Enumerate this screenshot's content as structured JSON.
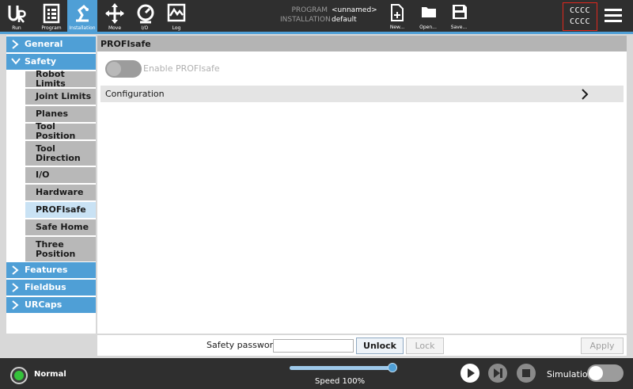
{
  "topbar": {
    "nav": [
      {
        "label": "Run",
        "icon": "ur-logo-icon"
      },
      {
        "label": "Program",
        "icon": "program-icon"
      },
      {
        "label": "Installation",
        "icon": "installation-icon",
        "active": true
      },
      {
        "label": "Move",
        "icon": "move-icon"
      },
      {
        "label": "I/O",
        "icon": "io-icon"
      },
      {
        "label": "Log",
        "icon": "log-icon"
      }
    ],
    "program_key": "PROGRAM",
    "program_value": "<unnamed>",
    "installation_key": "INSTALLATION",
    "installation_value": "default",
    "files": [
      {
        "label": "New...",
        "icon": "new-file-icon"
      },
      {
        "label": "Open...",
        "icon": "open-folder-icon"
      },
      {
        "label": "Save...",
        "icon": "save-icon"
      }
    ],
    "checksum_line1": "CCCC",
    "checksum_line2": "CCCC",
    "menu_icon": "hamburger-menu-icon"
  },
  "sidebar": {
    "categories": [
      {
        "label": "General",
        "expanded": false
      },
      {
        "label": "Safety",
        "expanded": true
      },
      {
        "label": "Features",
        "expanded": false
      },
      {
        "label": "Fieldbus",
        "expanded": false
      },
      {
        "label": "URCaps",
        "expanded": false
      }
    ],
    "safety_items": [
      {
        "label": "Robot Limits"
      },
      {
        "label": "Joint Limits"
      },
      {
        "label": "Planes"
      },
      {
        "label": "Tool Position"
      },
      {
        "label": "Tool Direction"
      },
      {
        "label": "I/O"
      },
      {
        "label": "Hardware"
      },
      {
        "label": "PROFIsafe",
        "active": true
      },
      {
        "label": "Safe Home"
      },
      {
        "label": "Three Position"
      }
    ]
  },
  "main": {
    "title": "PROFIsafe",
    "enable_label": "Enable PROFIsafe",
    "enable_on": false,
    "configuration_label": "Configuration"
  },
  "bottom": {
    "password_label": "Safety password",
    "password_value": "",
    "unlock_label": "Unlock",
    "lock_label": "Lock",
    "apply_label": "Apply"
  },
  "footer": {
    "status": "Normal",
    "status_color": "#35c23b",
    "speed_label": "Speed 100%",
    "speed_fraction": 1.0,
    "simulation_label": "Simulation",
    "simulation_on": false
  },
  "colors": {
    "accent": "#4f9fd6",
    "active_item": "#c9e2f4",
    "bar": "#2f2f2f"
  }
}
